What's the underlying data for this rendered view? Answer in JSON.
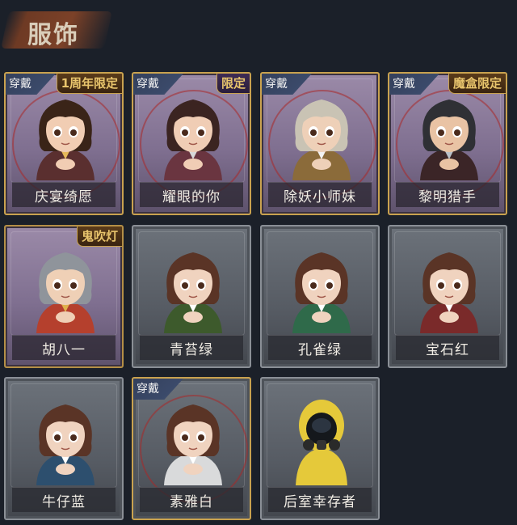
{
  "header": {
    "title": "服饰"
  },
  "outfits": [
    {
      "name": "庆宴绮愿",
      "equipped": true,
      "tag": "1周年限定",
      "style": "purple",
      "hair": "#3a2418",
      "skin": "#f1cdb3",
      "cloth": "#5a2f2f",
      "accent": "#e6b95a"
    },
    {
      "name": "耀眼的你",
      "equipped": true,
      "tag": "限定",
      "style": "purple",
      "hair": "#3b2421",
      "skin": "#f0cdb5",
      "cloth": "#6a3540",
      "accent": "#d8d8d8"
    },
    {
      "name": "除妖小师妹",
      "equipped": true,
      "tag": "",
      "style": "purple",
      "hair": "#c9c3b4",
      "skin": "#eed0b8",
      "cloth": "#8b6b3a",
      "accent": "#f2f2f2"
    },
    {
      "name": "黎明猎手",
      "equipped": true,
      "tag": "魔盒限定",
      "style": "purple",
      "hair": "#2f3035",
      "skin": "#e9c3a4",
      "cloth": "#3b2527",
      "accent": "#b9c0c8"
    },
    {
      "name": "胡八一",
      "equipped": false,
      "tag": "鬼吹灯",
      "style": "purple",
      "hair": "#8f949b",
      "skin": "#efd0b6",
      "cloth": "#b5402d",
      "accent": "#e0b04a"
    },
    {
      "name": "青苔绿",
      "equipped": false,
      "tag": "",
      "style": "gray",
      "hair": "#5a3426",
      "skin": "#f0d3bf",
      "cloth": "#3d5a2c",
      "accent": "#ffffff"
    },
    {
      "name": "孔雀绿",
      "equipped": false,
      "tag": "",
      "style": "gray",
      "hair": "#5a3426",
      "skin": "#f0d3bf",
      "cloth": "#2f6a4a",
      "accent": "#ffffff"
    },
    {
      "name": "宝石红",
      "equipped": false,
      "tag": "",
      "style": "gray",
      "hair": "#5a3426",
      "skin": "#f0d3bf",
      "cloth": "#7a2a2a",
      "accent": "#ffffff"
    },
    {
      "name": "牛仔蓝",
      "equipped": false,
      "tag": "",
      "style": "gray",
      "hair": "#5a3426",
      "skin": "#f0d3bf",
      "cloth": "#2d4f6e",
      "accent": "#ffffff"
    },
    {
      "name": "素雅白",
      "equipped": true,
      "tag": "",
      "style": "gray",
      "hair": "#5a3426",
      "skin": "#f0d3bf",
      "cloth": "#d9dadb",
      "accent": "#ffffff"
    },
    {
      "name": "后室幸存者",
      "equipped": false,
      "tag": "",
      "style": "gray",
      "hair": "#000000",
      "skin": "#e5c93a",
      "cloth": "#e5c93a",
      "accent": "#222222",
      "hazmat": true
    }
  ],
  "equip_label": "穿戴"
}
